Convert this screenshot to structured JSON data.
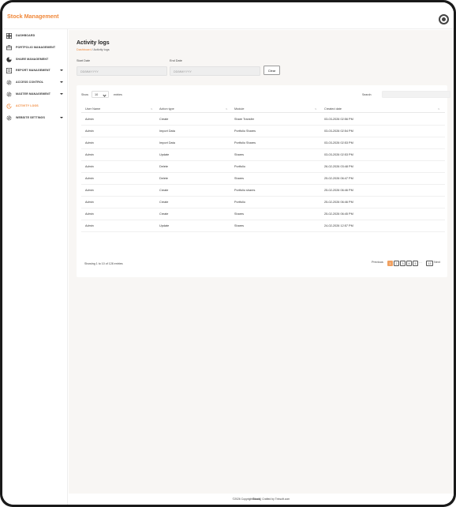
{
  "app": {
    "brand": "Stock Management"
  },
  "sidebar": {
    "items": [
      {
        "label": "DASHBOARD",
        "icon": "grid-icon",
        "has_chevron": false,
        "active": false
      },
      {
        "label": "PORTFOLIO MANAGEMENT",
        "icon": "briefcase-icon",
        "has_chevron": false,
        "active": false
      },
      {
        "label": "SHARE MANAGEMENT",
        "icon": "pie-icon",
        "has_chevron": false,
        "active": false
      },
      {
        "label": "REPORT MANAGEMENT",
        "icon": "report-icon",
        "has_chevron": true,
        "active": false
      },
      {
        "label": "ACCESS CONTROL",
        "icon": "gear-icon",
        "has_chevron": true,
        "active": false
      },
      {
        "label": "MASTER MANAGEMENT",
        "icon": "gear-icon",
        "has_chevron": true,
        "active": false
      },
      {
        "label": "ACTIVITY LOGS",
        "icon": "history-icon",
        "has_chevron": false,
        "active": true
      },
      {
        "label": "WEBSITE SETTINGS",
        "icon": "gear-icon",
        "has_chevron": true,
        "active": false
      }
    ]
  },
  "page": {
    "title": "Activity logs",
    "breadcrumb_link": "Dashboard",
    "breadcrumb_sep": " / ",
    "breadcrumb_current": "Activity logs"
  },
  "filters": {
    "start_label": "Start Date",
    "start_placeholder": "DD/MM/YYYY",
    "end_label": "End Date",
    "end_placeholder": "DD/MM/YYYY",
    "clear_label": "Clear"
  },
  "table_controls": {
    "show_label": "Show",
    "show_value": "10",
    "entries_label": "entries",
    "search_label": "Search:"
  },
  "table": {
    "columns": [
      "User Name",
      "Action type",
      "Module",
      "Created date"
    ],
    "rows": [
      [
        "Admin",
        "Create",
        "Share Transfer",
        "03-03-2026 02:56 PM"
      ],
      [
        "Admin",
        "Import Data",
        "Portfolio Shares",
        "03-03-2026 02:54 PM"
      ],
      [
        "Admin",
        "Import Data",
        "Portfolio Shares",
        "03-03-2026 02:53 PM"
      ],
      [
        "Admin",
        "Update",
        "Shares",
        "03-03-2026 02:53 PM"
      ],
      [
        "Admin",
        "Delete",
        "Portfolio",
        "26-02-2026 03:48 PM"
      ],
      [
        "Admin",
        "Delete",
        "Shares",
        "25-02-2026 06:47 PM"
      ],
      [
        "Admin",
        "Create",
        "Portfolio shares",
        "25-02-2026 06:46 PM"
      ],
      [
        "Admin",
        "Create",
        "Portfolio",
        "25-02-2026 06:46 PM"
      ],
      [
        "Admin",
        "Create",
        "Shares",
        "25-02-2026 06:45 PM"
      ],
      [
        "Admin",
        "Update",
        "Shares",
        "24-02-2026 12:57 PM"
      ]
    ]
  },
  "pagination": {
    "summary": "Showing 1 to 10 of 128 entries",
    "previous": "Previous",
    "pages": [
      "1",
      "2",
      "3",
      "4",
      "5"
    ],
    "ellipsis": "…",
    "last_page": "13",
    "next": "Next"
  },
  "footer": {
    "prefix": "©2026 Copyright ",
    "brand": "Stock",
    "suffix": " || Crafted by Trinsoft.com"
  },
  "colors": {
    "accent": "#f0883a",
    "content_bg": "#f8f6f4"
  }
}
